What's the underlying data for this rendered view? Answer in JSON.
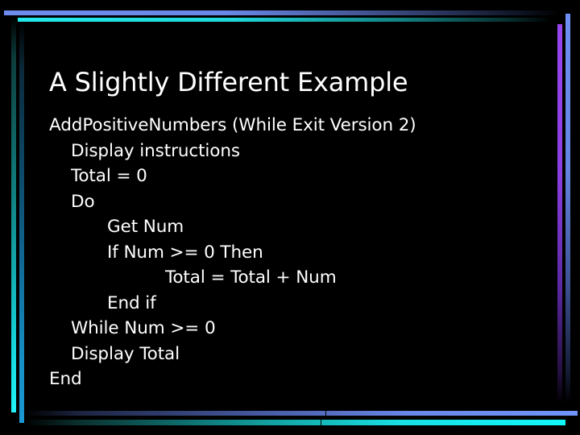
{
  "slide": {
    "title": "A Slightly Different Example",
    "lines": [
      {
        "text": "AddPositiveNumbers (While Exit Version 2)",
        "indent": 0
      },
      {
        "text": "Display instructions",
        "indent": 1
      },
      {
        "text": "Total = 0",
        "indent": 1
      },
      {
        "text": "Do",
        "indent": 1
      },
      {
        "text": "Get Num",
        "indent": 2
      },
      {
        "text": "If Num >= 0 Then",
        "indent": 2
      },
      {
        "text": "Total = Total + Num",
        "indent": 3
      },
      {
        "text": "End if",
        "indent": 2
      },
      {
        "text": "While Num >= 0",
        "indent": 1
      },
      {
        "text": "Display Total",
        "indent": 1
      },
      {
        "text": "End",
        "indent": 0
      }
    ]
  },
  "theme": {
    "background": "#000000",
    "text": "#ffffff",
    "accent_blue": "#6e8cf0",
    "accent_cyan": "#22e8ea",
    "accent_purple": "#9846f0"
  }
}
